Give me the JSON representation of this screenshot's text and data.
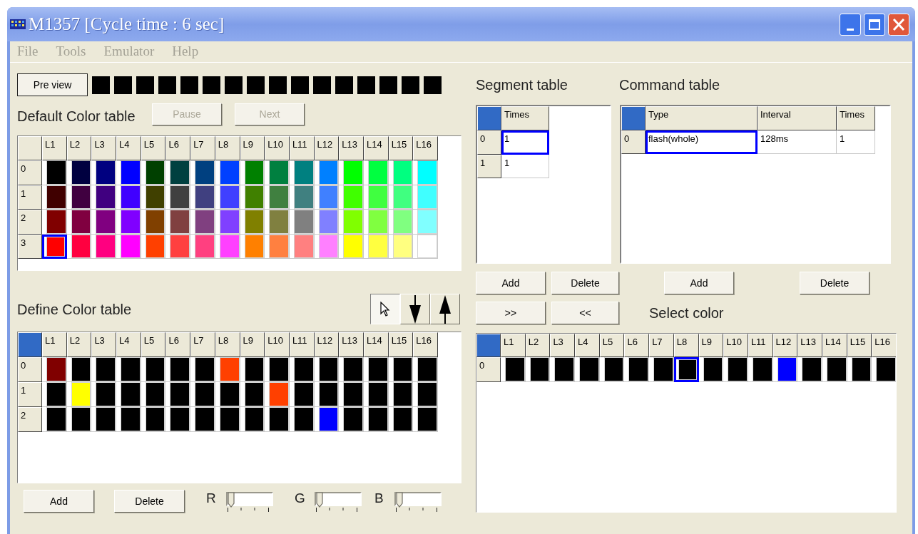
{
  "window": {
    "title": "M1357 [Cycle time : 6 sec]"
  },
  "menu": [
    "File",
    "Tools",
    "Emulator",
    "Help"
  ],
  "preview": {
    "button": "Pre view",
    "leds": [
      {
        "color": "#000000"
      },
      {
        "color": "#000000"
      },
      {
        "color": "#000000"
      },
      {
        "color": "#000000"
      },
      {
        "color": "#000000"
      },
      {
        "color": "#000000"
      },
      {
        "color": "#000000"
      },
      {
        "color": "#000000"
      },
      {
        "color": "#000000"
      },
      {
        "color": "#000000"
      },
      {
        "color": "#000000"
      },
      {
        "color": "#000000"
      },
      {
        "color": "#000000"
      },
      {
        "color": "#000000"
      },
      {
        "color": "#000000"
      },
      {
        "color": "#000000"
      }
    ]
  },
  "default_color_table": {
    "title": "Default Color table",
    "buttons": [
      {
        "label": "Pause",
        "disabled": true
      },
      {
        "label": "Next",
        "disabled": true
      }
    ],
    "corner_selected": false,
    "columns": [
      "L1",
      "L2",
      "L3",
      "L4",
      "L5",
      "L6",
      "L7",
      "L8",
      "L9",
      "L10",
      "L11",
      "L12",
      "L13",
      "L14",
      "L15",
      "L16"
    ],
    "rows": [
      {
        "label": "0",
        "cells": [
          {
            "color": "#000000",
            "selected": false
          },
          {
            "color": "#000040",
            "selected": false
          },
          {
            "color": "#000080",
            "selected": false
          },
          {
            "color": "#0000ff",
            "selected": false
          },
          {
            "color": "#004000",
            "selected": false
          },
          {
            "color": "#004040",
            "selected": false
          },
          {
            "color": "#004080",
            "selected": false
          },
          {
            "color": "#0040ff",
            "selected": false
          },
          {
            "color": "#008000",
            "selected": false
          },
          {
            "color": "#008040",
            "selected": false
          },
          {
            "color": "#008080",
            "selected": false
          },
          {
            "color": "#0080ff",
            "selected": false
          },
          {
            "color": "#00ff00",
            "selected": false
          },
          {
            "color": "#00ff40",
            "selected": false
          },
          {
            "color": "#00ff80",
            "selected": false
          },
          {
            "color": "#00ffff",
            "selected": false
          }
        ]
      },
      {
        "label": "1",
        "cells": [
          {
            "color": "#400000",
            "selected": false
          },
          {
            "color": "#400040",
            "selected": false
          },
          {
            "color": "#400080",
            "selected": false
          },
          {
            "color": "#4000ff",
            "selected": false
          },
          {
            "color": "#404000",
            "selected": false
          },
          {
            "color": "#404040",
            "selected": false
          },
          {
            "color": "#404080",
            "selected": false
          },
          {
            "color": "#4040ff",
            "selected": false
          },
          {
            "color": "#408000",
            "selected": false
          },
          {
            "color": "#408040",
            "selected": false
          },
          {
            "color": "#408080",
            "selected": false
          },
          {
            "color": "#4080ff",
            "selected": false
          },
          {
            "color": "#40ff00",
            "selected": false
          },
          {
            "color": "#40ff40",
            "selected": false
          },
          {
            "color": "#40ff80",
            "selected": false
          },
          {
            "color": "#40ffff",
            "selected": false
          }
        ]
      },
      {
        "label": "2",
        "cells": [
          {
            "color": "#800000",
            "selected": false
          },
          {
            "color": "#800040",
            "selected": false
          },
          {
            "color": "#800080",
            "selected": false
          },
          {
            "color": "#8000ff",
            "selected": false
          },
          {
            "color": "#804000",
            "selected": false
          },
          {
            "color": "#804040",
            "selected": false
          },
          {
            "color": "#804080",
            "selected": false
          },
          {
            "color": "#8040ff",
            "selected": false
          },
          {
            "color": "#808000",
            "selected": false
          },
          {
            "color": "#808040",
            "selected": false
          },
          {
            "color": "#808080",
            "selected": false
          },
          {
            "color": "#8080ff",
            "selected": false
          },
          {
            "color": "#80ff00",
            "selected": false
          },
          {
            "color": "#80ff40",
            "selected": false
          },
          {
            "color": "#80ff80",
            "selected": false
          },
          {
            "color": "#80ffff",
            "selected": false
          }
        ]
      },
      {
        "label": "3",
        "cells": [
          {
            "color": "#ff0000",
            "selected": true
          },
          {
            "color": "#ff0040",
            "selected": false
          },
          {
            "color": "#ff0080",
            "selected": false
          },
          {
            "color": "#ff00ff",
            "selected": false
          },
          {
            "color": "#ff4000",
            "selected": false
          },
          {
            "color": "#ff4040",
            "selected": false
          },
          {
            "color": "#ff4080",
            "selected": false
          },
          {
            "color": "#ff40ff",
            "selected": false
          },
          {
            "color": "#ff8000",
            "selected": false
          },
          {
            "color": "#ff8040",
            "selected": false
          },
          {
            "color": "#ff8080",
            "selected": false
          },
          {
            "color": "#ff80ff",
            "selected": false
          },
          {
            "color": "#ffff00",
            "selected": false
          },
          {
            "color": "#ffff40",
            "selected": false
          },
          {
            "color": "#ffff80",
            "selected": false
          },
          {
            "color": "#ffffff",
            "selected": false
          }
        ]
      }
    ]
  },
  "define_color_table": {
    "title": "Define Color table",
    "tools": [
      {
        "kind": "pointer",
        "selected": true
      },
      {
        "kind": "down",
        "selected": false
      },
      {
        "kind": "up",
        "selected": false
      }
    ],
    "corner_selected": true,
    "columns": [
      "L1",
      "L2",
      "L3",
      "L4",
      "L5",
      "L6",
      "L7",
      "L8",
      "L9",
      "L10",
      "L11",
      "L12",
      "L13",
      "L14",
      "L15",
      "L16"
    ],
    "rows": [
      {
        "label": "0",
        "cells": [
          {
            "color": "#800000",
            "selected": false
          },
          {
            "color": "#000000",
            "selected": false
          },
          {
            "color": "#000000",
            "selected": false
          },
          {
            "color": "#000000",
            "selected": false
          },
          {
            "color": "#000000",
            "selected": false
          },
          {
            "color": "#000000",
            "selected": false
          },
          {
            "color": "#000000",
            "selected": false
          },
          {
            "color": "#ff4000",
            "selected": false
          },
          {
            "color": "#000000",
            "selected": false
          },
          {
            "color": "#000000",
            "selected": false
          },
          {
            "color": "#000000",
            "selected": false
          },
          {
            "color": "#000000",
            "selected": false
          },
          {
            "color": "#000000",
            "selected": false
          },
          {
            "color": "#000000",
            "selected": false
          },
          {
            "color": "#000000",
            "selected": false
          },
          {
            "color": "#000000",
            "selected": false
          }
        ]
      },
      {
        "label": "1",
        "cells": [
          {
            "color": "#000000",
            "selected": false
          },
          {
            "color": "#ffff00",
            "selected": false
          },
          {
            "color": "#000000",
            "selected": false
          },
          {
            "color": "#000000",
            "selected": false
          },
          {
            "color": "#000000",
            "selected": false
          },
          {
            "color": "#000000",
            "selected": false
          },
          {
            "color": "#000000",
            "selected": false
          },
          {
            "color": "#000000",
            "selected": false
          },
          {
            "color": "#000000",
            "selected": false
          },
          {
            "color": "#ff4000",
            "selected": false
          },
          {
            "color": "#000000",
            "selected": false
          },
          {
            "color": "#000000",
            "selected": false
          },
          {
            "color": "#000000",
            "selected": false
          },
          {
            "color": "#000000",
            "selected": false
          },
          {
            "color": "#000000",
            "selected": false
          },
          {
            "color": "#000000",
            "selected": false
          }
        ]
      },
      {
        "label": "2",
        "cells": [
          {
            "color": "#000000",
            "selected": false
          },
          {
            "color": "#000000",
            "selected": false
          },
          {
            "color": "#000000",
            "selected": false
          },
          {
            "color": "#000000",
            "selected": false
          },
          {
            "color": "#000000",
            "selected": false
          },
          {
            "color": "#000000",
            "selected": false
          },
          {
            "color": "#000000",
            "selected": false
          },
          {
            "color": "#000000",
            "selected": false
          },
          {
            "color": "#000000",
            "selected": false
          },
          {
            "color": "#000000",
            "selected": false
          },
          {
            "color": "#000000",
            "selected": false
          },
          {
            "color": "#0000ff",
            "selected": false
          },
          {
            "color": "#000000",
            "selected": false
          },
          {
            "color": "#000000",
            "selected": false
          },
          {
            "color": "#000000",
            "selected": false
          },
          {
            "color": "#000000",
            "selected": false
          }
        ]
      }
    ],
    "buttons": [
      "Add",
      "Delete"
    ],
    "sliders": [
      {
        "label": "R",
        "level": 0
      },
      {
        "label": "G",
        "level": 0
      },
      {
        "label": "B",
        "level": 0
      }
    ]
  },
  "segment_table": {
    "title": "Segment table",
    "corner_selected": true,
    "columns": [
      "Times"
    ],
    "rows": [
      {
        "label": "0",
        "cells": [
          {
            "text": "1",
            "selected": true
          }
        ]
      },
      {
        "label": "1",
        "cells": [
          {
            "text": "1",
            "selected": false
          }
        ]
      }
    ],
    "buttons": [
      "Add",
      "Delete",
      ">>",
      "<<"
    ]
  },
  "command_table": {
    "title": "Command table",
    "corner_selected": true,
    "columns": [
      "Type",
      "Interval",
      "Times"
    ],
    "rows": [
      {
        "label": "0",
        "cells": [
          {
            "text": "flash(whole)",
            "selected": true
          },
          {
            "text": "128ms",
            "selected": false
          },
          {
            "text": "1",
            "selected": false
          }
        ]
      }
    ],
    "buttons": [
      "Add",
      "Delete"
    ]
  },
  "select_color": {
    "title": "Select color",
    "corner_selected": true,
    "columns": [
      "L1",
      "L2",
      "L3",
      "L4",
      "L5",
      "L6",
      "L7",
      "L8",
      "L9",
      "L10",
      "L11",
      "L12",
      "L13",
      "L14",
      "L15",
      "L16"
    ],
    "rows": [
      {
        "label": "0",
        "cells": [
          {
            "color": "#000000",
            "selected": false
          },
          {
            "color": "#000000",
            "selected": false
          },
          {
            "color": "#000000",
            "selected": false
          },
          {
            "color": "#000000",
            "selected": false
          },
          {
            "color": "#000000",
            "selected": false
          },
          {
            "color": "#000000",
            "selected": false
          },
          {
            "color": "#000000",
            "selected": false
          },
          {
            "color": "#000000",
            "selected": true
          },
          {
            "color": "#000000",
            "selected": false
          },
          {
            "color": "#000000",
            "selected": false
          },
          {
            "color": "#000000",
            "selected": false
          },
          {
            "color": "#0000ff",
            "selected": false
          },
          {
            "color": "#000000",
            "selected": false
          },
          {
            "color": "#000000",
            "selected": false
          },
          {
            "color": "#000000",
            "selected": false
          },
          {
            "color": "#000000",
            "selected": false
          }
        ]
      }
    ]
  }
}
